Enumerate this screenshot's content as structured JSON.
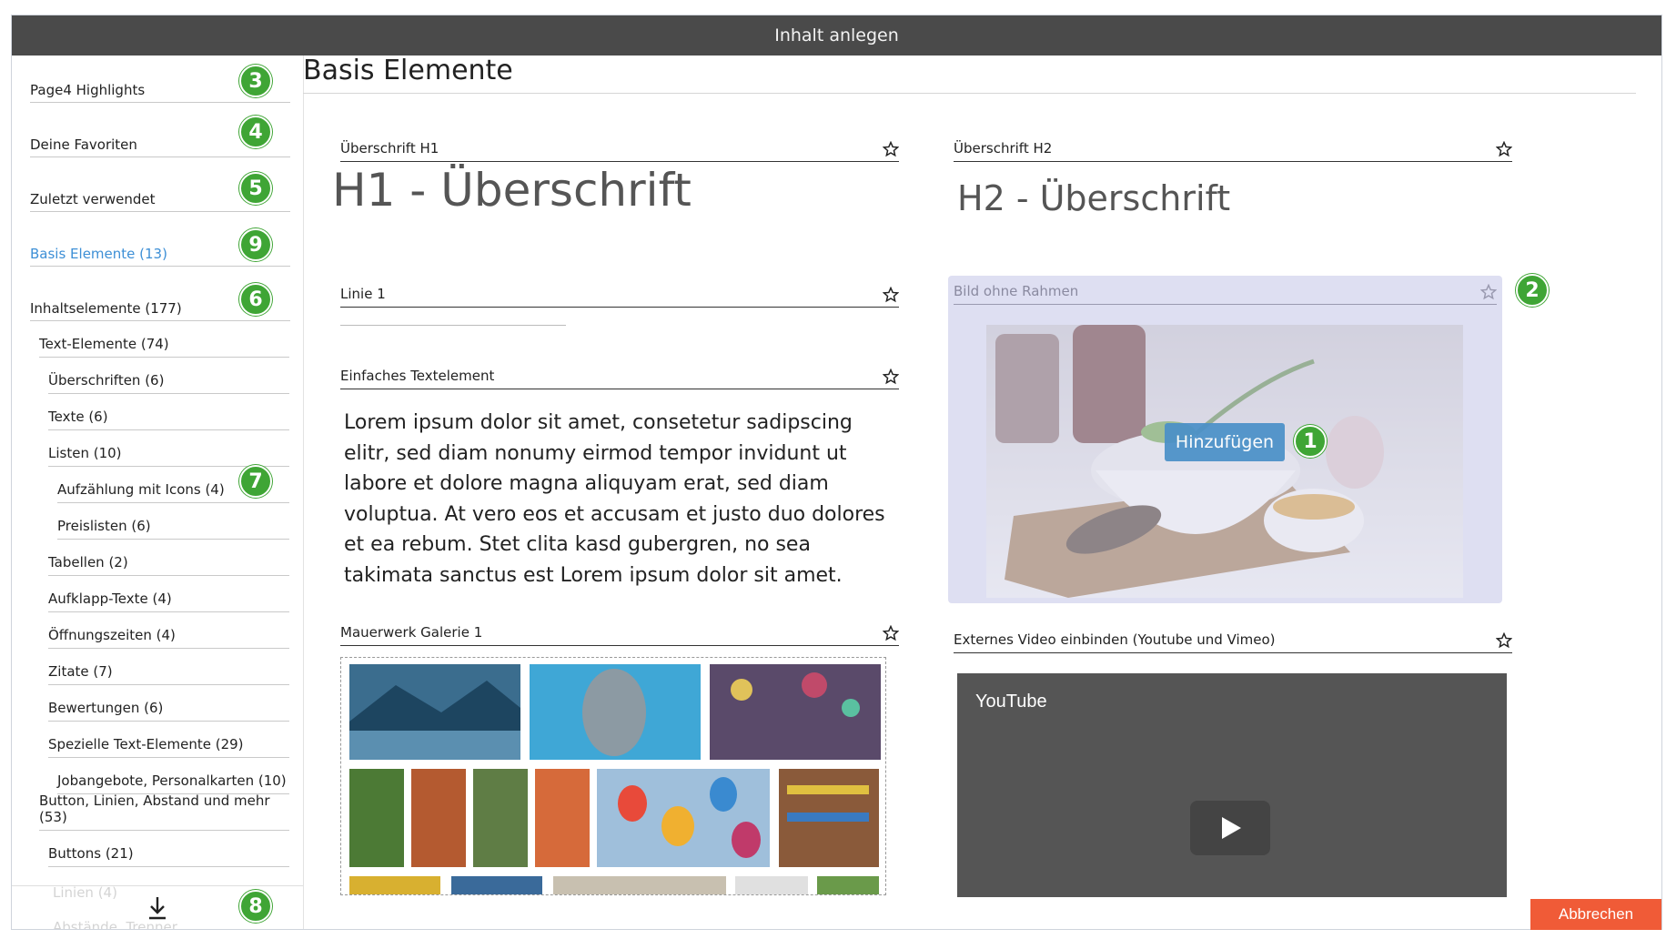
{
  "window": {
    "title": "Inhalt anlegen"
  },
  "sidebar": {
    "top_items": [
      {
        "label": "Page4 Highlights",
        "badge": "3"
      },
      {
        "label": "Deine Favoriten",
        "badge": "4"
      },
      {
        "label": "Zuletzt verwendet",
        "badge": "5"
      },
      {
        "label": "Basis Elemente (13)",
        "badge": "9"
      },
      {
        "label": "Inhaltselemente (177)",
        "badge": "6"
      }
    ],
    "sub_items": [
      {
        "label": "Text-Elemente (74)"
      },
      {
        "label": "Überschriften (6)"
      },
      {
        "label": "Texte (6)"
      },
      {
        "label": "Listen (10)"
      },
      {
        "label": "Aufzählung mit Icons (4)",
        "badge": "7"
      },
      {
        "label": "Preislisten (6)"
      },
      {
        "label": "Tabellen (2)"
      },
      {
        "label": "Aufklapp-Texte (4)"
      },
      {
        "label": "Öffnungszeiten (4)"
      },
      {
        "label": "Zitate (7)"
      },
      {
        "label": "Bewertungen (6)"
      },
      {
        "label": "Spezielle Text-Elemente (29)"
      },
      {
        "label": "Jobangebote, Personalkarten (10)"
      },
      {
        "label": "Button, Linien, Abstand und mehr (53)"
      },
      {
        "label": "Buttons (21)"
      }
    ],
    "footer": {
      "faded_1": "Linien (4)",
      "faded_2": "Abstände, Trenner",
      "badge": "8",
      "download_icon": "download-icon"
    }
  },
  "main": {
    "title": "Basis Elemente",
    "elements": {
      "h1": {
        "label": "Überschrift H1",
        "sample": "H1 - Überschrift"
      },
      "h2": {
        "label": "Überschrift H2",
        "sample": "H2 - Überschrift"
      },
      "linie": {
        "label": "Linie 1"
      },
      "bild": {
        "label": "Bild ohne Rahmen",
        "add_label": "Hinzufügen",
        "badge_top": "2",
        "badge_btn": "1"
      },
      "text": {
        "label": "Einfaches Textelement",
        "sample": "Lorem ipsum dolor sit amet, consetetur sadipscing elitr, sed diam nonumy eirmod tempor invidunt ut labore et dolore magna aliquyam erat, sed diam voluptua. At vero eos et accusam et justo duo dolores et ea rebum. Stet clita kasd gubergren, no sea takimata sanctus est Lorem ipsum dolor sit amet."
      },
      "galerie": {
        "label": "Mauerwerk Galerie 1"
      },
      "video": {
        "label": "Externes Video einbinden (Youtube und Vimeo)",
        "brand": "YouTube"
      }
    }
  },
  "footer": {
    "cancel_label": "Abbrechen"
  },
  "colors": {
    "titlebar": "#4a4a4a",
    "accent_blue": "#3d8fd6",
    "badge_green": "#3fa535",
    "cancel_orange": "#f05b37",
    "highlight_panel": "#dedff2"
  }
}
